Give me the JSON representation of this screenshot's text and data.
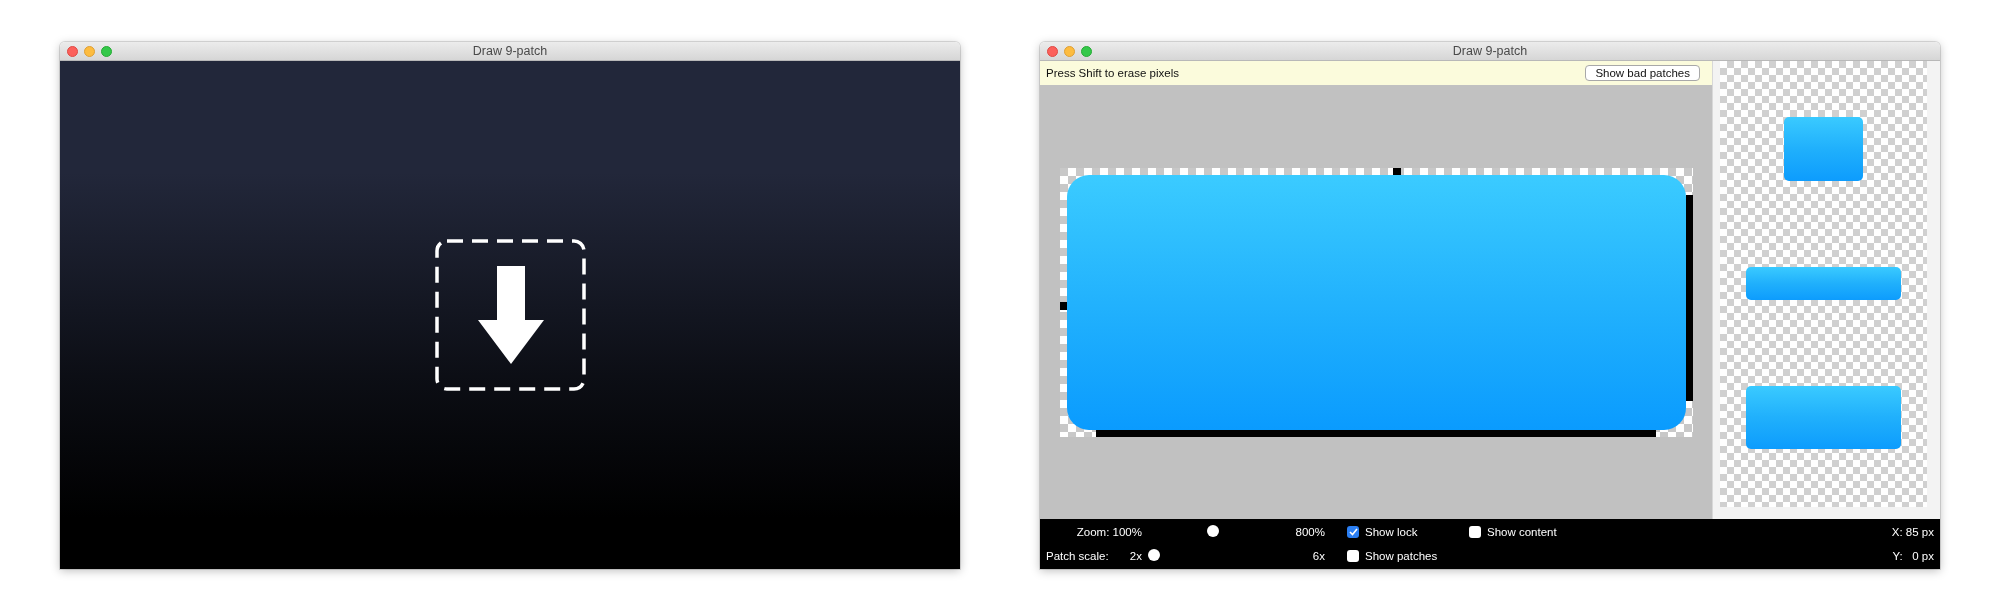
{
  "drop_window": {
    "title": "Draw 9-patch"
  },
  "editor_window": {
    "title": "Draw 9-patch",
    "hint": "Press Shift to erase pixels",
    "bad_patches_button": "Show bad patches",
    "zoom_slider": {
      "label": "Zoom: 100%",
      "max_label": "800%",
      "level": 0.46
    },
    "patch_scale_slider": {
      "label": "Patch scale:",
      "min_label": "2x",
      "max_label": "6x",
      "level": 0
    },
    "checkboxes": [
      {
        "label": "Show lock",
        "checked": true
      },
      {
        "label": "Show content",
        "checked": false
      },
      {
        "label": "Show patches",
        "checked": false
      }
    ],
    "coordinates": [
      "X: 85 px",
      "Y:   0 px"
    ]
  }
}
